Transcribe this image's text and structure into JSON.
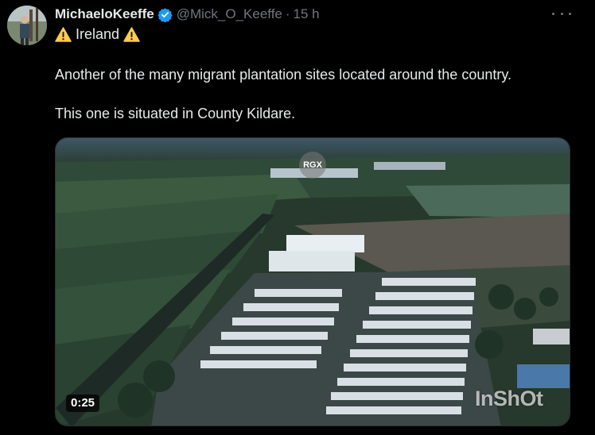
{
  "tweet": {
    "display_name": "MichaeloKeeffe",
    "handle": "@Mick_O_Keeffe",
    "separator": "·",
    "time": "15 h",
    "location_line": "Ireland",
    "paragraph_1": "Another of the many migrant plantation sites located around the country.",
    "paragraph_2": "This one is situated in County Kildare.",
    "icons": {
      "verified": "verified-badge-icon",
      "warning": "warning-icon",
      "more": "more-options-icon"
    }
  },
  "video": {
    "duration": "0:25",
    "overlay_badge": "RGX",
    "watermark": "InShOt"
  },
  "colors": {
    "background": "#000000",
    "text_primary": "#e7e9ea",
    "text_secondary": "#71767b",
    "verified_blue": "#1d9bf0",
    "warning_yellow": "#ffcc4d"
  }
}
